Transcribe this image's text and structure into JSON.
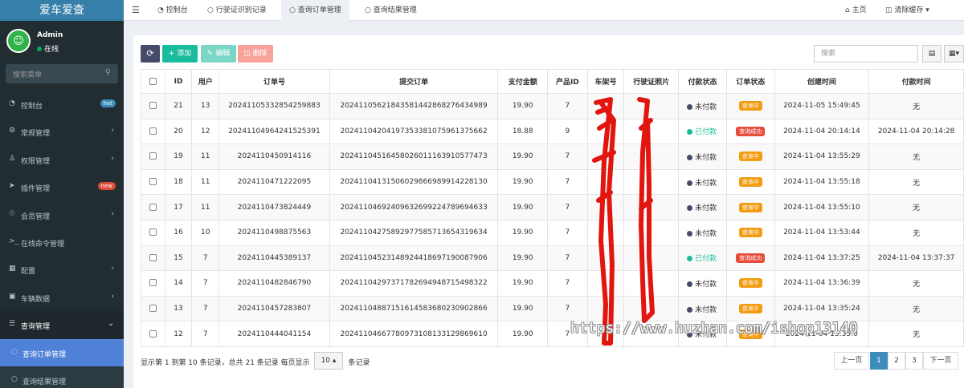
{
  "app": {
    "logo": "爱车爱查"
  },
  "user": {
    "name": "Admin",
    "status": "在线"
  },
  "sidebar": {
    "search_placeholder": "搜索菜单",
    "items": [
      {
        "label": "控制台",
        "icon": "dashboard-icon",
        "badge": "hot",
        "badge_color": "#3c8dbc"
      },
      {
        "label": "常规管理",
        "icon": "cogs-icon"
      },
      {
        "label": "权限管理",
        "icon": "group-icon"
      },
      {
        "label": "插件管理",
        "icon": "rocket-icon",
        "badge": "new",
        "badge_color": "#dd4b39"
      },
      {
        "label": "会员管理",
        "icon": "user-circle-icon"
      },
      {
        "label": "在线命令管理",
        "icon": "terminal-icon"
      },
      {
        "label": "配置",
        "icon": "table-icon"
      },
      {
        "label": "车辆数据",
        "icon": "car-icon"
      },
      {
        "label": "查询管理",
        "icon": "list-icon"
      },
      {
        "label": "查询订单管理",
        "icon": "circle-icon"
      },
      {
        "label": "查询结果管理",
        "icon": "circle-icon"
      }
    ]
  },
  "topbar": {
    "tabs": [
      {
        "label": "控制台",
        "icon": "dashboard-icon"
      },
      {
        "label": "行驶证识别记录",
        "icon": "circle-icon"
      },
      {
        "label": "查询订单管理",
        "icon": "circle-icon"
      },
      {
        "label": "查询结果管理",
        "icon": "circle-icon"
      }
    ],
    "home": "主页",
    "clear_cache": "清除缓存"
  },
  "toolbar": {
    "refresh": "⟳",
    "add": "添加",
    "edit": "编辑",
    "delete": "删除",
    "search_placeholder": "搜索"
  },
  "colors": {
    "add": "#18bc9c",
    "edit": "#7ad7c6",
    "delete": "#f9a29c",
    "refresh": "#444c69",
    "paid": "#18bc9c",
    "unpaid": "#444c69",
    "querying": "#f39c12",
    "success": "#e74c3c"
  },
  "table": {
    "columns": [
      "ID",
      "用户",
      "订单号",
      "提交订单",
      "支付金额",
      "产品ID",
      "车架号",
      "行驶证照片",
      "付款状态",
      "订单状态",
      "创建时间",
      "付款时间"
    ],
    "rows": [
      {
        "id": "21",
        "user": "13",
        "order_no": "20241105332854259883",
        "submit": "20241105621843581442868276434989",
        "amount": "19.90",
        "product": "7",
        "pay_status": "未付款",
        "paid": false,
        "order_status": "查询中",
        "created": "2024-11-05 15:49:45",
        "pay_time": "无"
      },
      {
        "id": "20",
        "user": "12",
        "order_no": "20241104964241525391",
        "submit": "20241104204197353381075961375662",
        "amount": "18.88",
        "product": "9",
        "pay_status": "已付款",
        "paid": true,
        "order_status": "查询成功",
        "created": "2024-11-04 20:14:14",
        "pay_time": "2024-11-04 20:14:28"
      },
      {
        "id": "19",
        "user": "11",
        "order_no": "2024110450914116",
        "submit": "20241104516458026011163910577473",
        "amount": "19.90",
        "product": "7",
        "pay_status": "未付款",
        "paid": false,
        "order_status": "查询中",
        "created": "2024-11-04 13:55:29",
        "pay_time": "无"
      },
      {
        "id": "18",
        "user": "11",
        "order_no": "2024110471222095",
        "submit": "20241104131506029866989914228130",
        "amount": "19.90",
        "product": "7",
        "pay_status": "未付款",
        "paid": false,
        "order_status": "查询中",
        "created": "2024-11-04 13:55:18",
        "pay_time": "无"
      },
      {
        "id": "17",
        "user": "11",
        "order_no": "2024110473824449",
        "submit": "20241104692409632699224789694633",
        "amount": "19.90",
        "product": "7",
        "pay_status": "未付款",
        "paid": false,
        "order_status": "查询中",
        "created": "2024-11-04 13:55:10",
        "pay_time": "无"
      },
      {
        "id": "16",
        "user": "10",
        "order_no": "2024110498875563",
        "submit": "20241104275892977585713654319634",
        "amount": "19.90",
        "product": "7",
        "pay_status": "未付款",
        "paid": false,
        "order_status": "查询中",
        "created": "2024-11-04 13:53:44",
        "pay_time": "无"
      },
      {
        "id": "15",
        "user": "7",
        "order_no": "2024110445389137",
        "submit": "20241104523148924418697190087906",
        "amount": "19.90",
        "product": "7",
        "pay_status": "已付款",
        "paid": true,
        "order_status": "查询成功",
        "created": "2024-11-04 13:37:25",
        "pay_time": "2024-11-04 13:37:37"
      },
      {
        "id": "14",
        "user": "7",
        "order_no": "2024110482846790",
        "submit": "20241104297371782694948715498322",
        "amount": "19.90",
        "product": "7",
        "pay_status": "未付款",
        "paid": false,
        "order_status": "查询中",
        "created": "2024-11-04 13:36:39",
        "pay_time": "无"
      },
      {
        "id": "13",
        "user": "7",
        "order_no": "2024110457283807",
        "submit": "20241104887151614583680230902866",
        "amount": "19.90",
        "product": "7",
        "pay_status": "未付款",
        "paid": false,
        "order_status": "查询中",
        "created": "2024-11-04 13:35:24",
        "pay_time": "无"
      },
      {
        "id": "12",
        "user": "7",
        "order_no": "2024110444041154",
        "submit": "20241104667780973108133129869610",
        "amount": "19.90",
        "product": "7",
        "pay_status": "未付款",
        "paid": false,
        "order_status": "查询中",
        "created": "2024-11-04 13:35:0",
        "pay_time": "无"
      }
    ]
  },
  "footer": {
    "summary": "显示第 1 到第 10 条记录，总共 21 条记录 每页显示",
    "page_size": "10",
    "suffix": "条记录"
  },
  "pagination": {
    "prev": "上一页",
    "pages": [
      "1",
      "2",
      "3"
    ],
    "next": "下一页"
  },
  "watermark": "https://www.huzhan.com/ishop13140"
}
